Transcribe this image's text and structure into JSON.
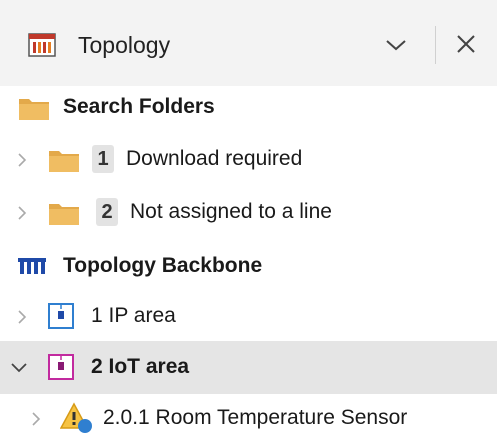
{
  "header": {
    "title": "Topology",
    "title_icon": "topology-window-icon",
    "dropdown_icon": "chevron-down-icon",
    "close_icon": "close-icon"
  },
  "tree": {
    "search_folders": {
      "label": "Search Folders",
      "icon": "folder-icon"
    },
    "download_required": {
      "badge": "1",
      "label": "Download required",
      "icon": "folder-icon"
    },
    "not_assigned": {
      "badge": "2",
      "label": "Not assigned to a line",
      "icon": "folder-icon"
    },
    "backbone": {
      "label": "Topology Backbone",
      "icon": "backbone-icon"
    },
    "ip_area": {
      "label": "1 IP area",
      "icon": "ip-area-icon"
    },
    "iot_area": {
      "label": "2 IoT area",
      "icon": "iot-area-icon",
      "selected": true
    },
    "sensor": {
      "label": "2.0.1 Room Temperature Sensor",
      "icon": "warning-device-icon"
    }
  },
  "colors": {
    "folder": "#e3a94a",
    "ip_area": "#2f7fd0",
    "iot_area": "#c22a9f",
    "backbone": "#1f4aa8",
    "selected_row": "#e5e5e5"
  }
}
